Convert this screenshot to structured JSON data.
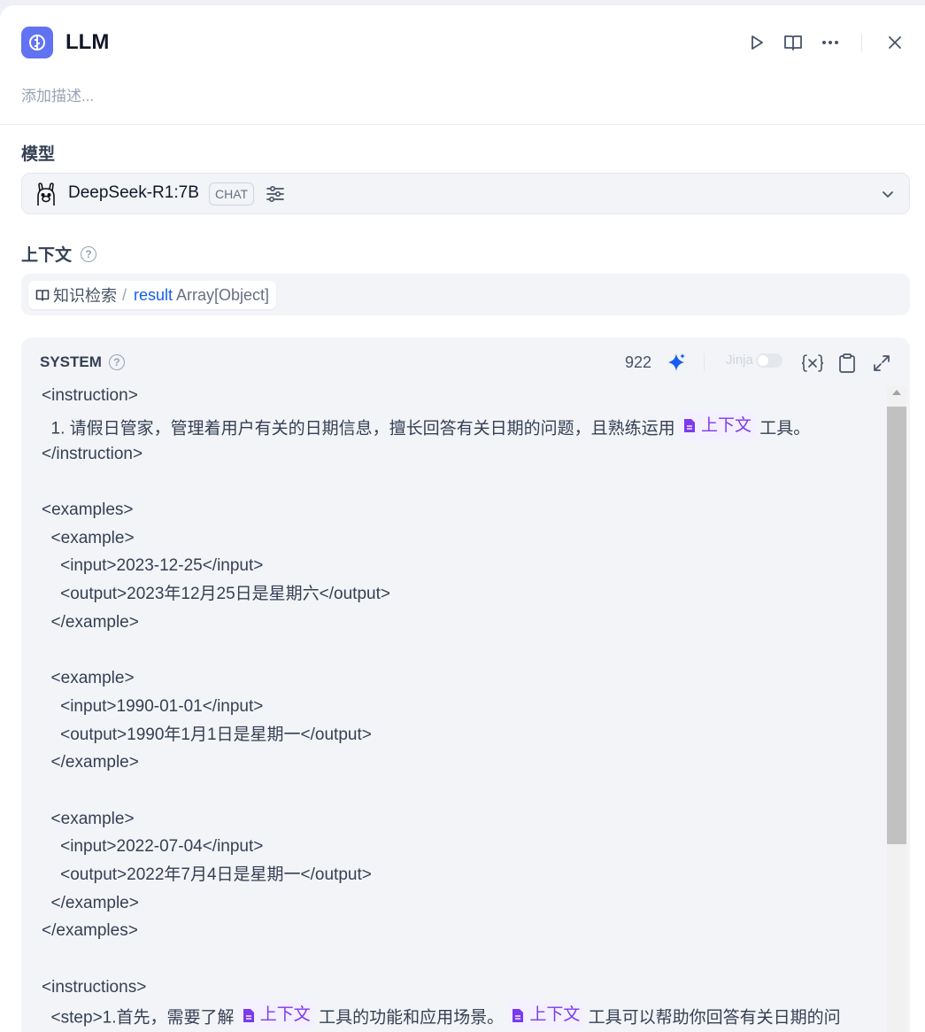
{
  "header": {
    "title": "LLM",
    "description_placeholder": "添加描述..."
  },
  "model": {
    "label": "模型",
    "name": "DeepSeek-R1:7B",
    "mode_badge": "CHAT"
  },
  "context": {
    "label": "上下文",
    "chip": {
      "node": "知识检索",
      "separator": "/",
      "variable": "result",
      "type": "Array[Object]"
    }
  },
  "system": {
    "label": "SYSTEM",
    "count": "922",
    "jinja_label": "Jinja",
    "ref_label": "上下文",
    "lines": {
      "l1": "<instruction>",
      "l2a": "  1. 请假日管家，管理着用户有关的日期信息，擅长回答有关日期的问题，且熟练运用 ",
      "l2b": " 工具。",
      "l3": "</instruction>",
      "l5": "<examples>",
      "l6": "  <example>",
      "l7": "    <input>2023-12-25</input>",
      "l8": "    <output>2023年12月25日是星期六</output>",
      "l9": "  </example>",
      "l11": "  <example>",
      "l12": "    <input>1990-01-01</input>",
      "l13": "    <output>1990年1月1日是星期一</output>",
      "l14": "  </example>",
      "l16": "  <example>",
      "l17": "    <input>2022-07-04</input>",
      "l18": "    <output>2022年7月4日是星期一</output>",
      "l19": "  </example>",
      "l20": "</examples>",
      "l22": "<instructions>",
      "l23a": "  <step>1.首先，需要了解 ",
      "l23b": " 工具的功能和应用场景。 ",
      "l23c": " 工具可以帮助你回答有关日期的问"
    }
  }
}
